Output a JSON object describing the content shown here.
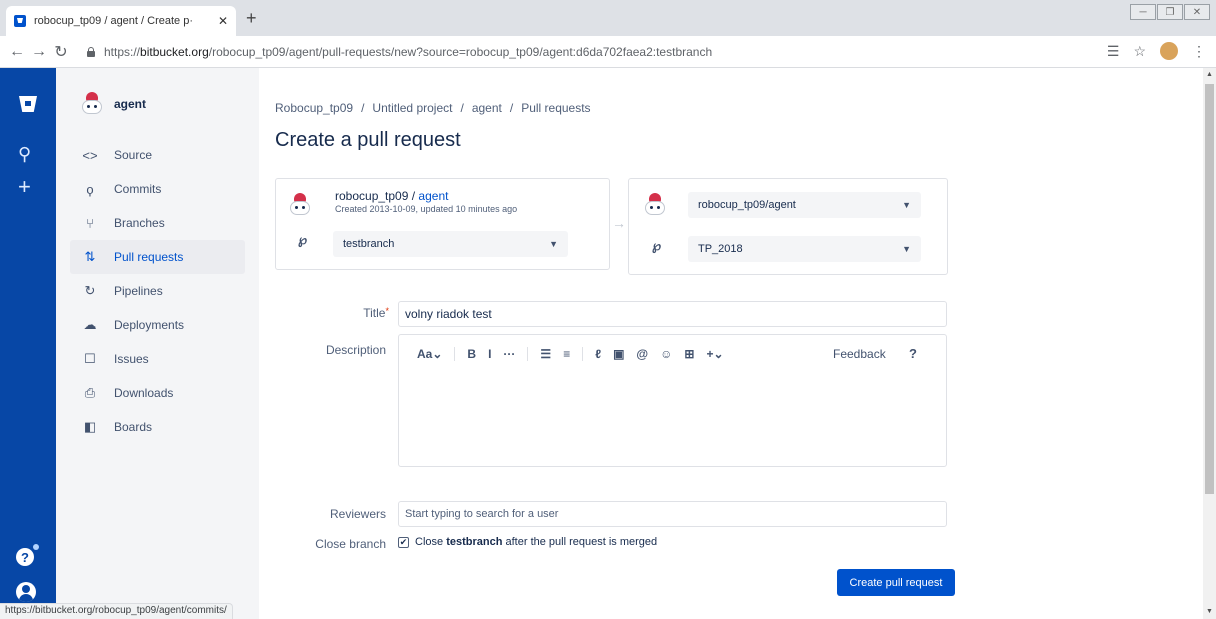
{
  "browser": {
    "tab_title": "robocup_tp09 / agent / Create p·",
    "tab_close": "✕",
    "new_tab": "+",
    "url_scheme": "https://",
    "url_host": "bitbucket.org",
    "url_path": "/robocup_tp09/agent/pull-requests/new?source=robocup_tp09/agent:d6da702faea2:testbranch",
    "status_url": "https://bitbucket.org/robocup_tp09/agent/commits/"
  },
  "sidebar": {
    "repo_name": "agent",
    "items": [
      {
        "label": "Source",
        "icon": "code-icon",
        "glyph": "<>"
      },
      {
        "label": "Commits",
        "icon": "commit-icon",
        "glyph": "ϙ"
      },
      {
        "label": "Branches",
        "icon": "branch-icon",
        "glyph": "⑂"
      },
      {
        "label": "Pull requests",
        "icon": "pull-request-icon",
        "glyph": "⇅"
      },
      {
        "label": "Pipelines",
        "icon": "pipelines-icon",
        "glyph": "↻"
      },
      {
        "label": "Deployments",
        "icon": "deployments-icon",
        "glyph": "☁"
      },
      {
        "label": "Issues",
        "icon": "issues-icon",
        "glyph": "☐"
      },
      {
        "label": "Downloads",
        "icon": "downloads-icon",
        "glyph": "⎙"
      },
      {
        "label": "Boards",
        "icon": "boards-icon",
        "glyph": "◧"
      }
    ],
    "active_index": 3
  },
  "breadcrumb": [
    "Robocup_tp09",
    "Untitled project",
    "agent",
    "Pull requests"
  ],
  "page_title": "Create a pull request",
  "source": {
    "owner": "robocup_tp09",
    "repo": "agent",
    "meta": "Created 2013-10-09, updated 10 minutes ago",
    "branch": "testbranch"
  },
  "destination": {
    "repo": "robocup_tp09/agent",
    "branch": "TP_2018"
  },
  "form": {
    "title_label": "Title",
    "title_required": "*",
    "title_value": "volny riadok test",
    "description_label": "Description",
    "toolbar": [
      "Aa⌄",
      "B",
      "I",
      "···",
      "☰",
      "≡",
      "ℓ",
      "▣",
      "@",
      "☺",
      "⊞",
      "+⌄"
    ],
    "feedback": "Feedback",
    "help": "?",
    "reviewers_label": "Reviewers",
    "reviewers_placeholder": "Start typing to search for a user",
    "close_branch_label": "Close branch",
    "close_prefix": "Close",
    "close_branch_name": "testbranch",
    "close_suffix": "after the pull request is merged",
    "submit_label": "Create pull request"
  },
  "colors": {
    "global_nav": "#0747a6",
    "primary": "#0052cc",
    "sidebar_bg": "#f4f5f7"
  }
}
